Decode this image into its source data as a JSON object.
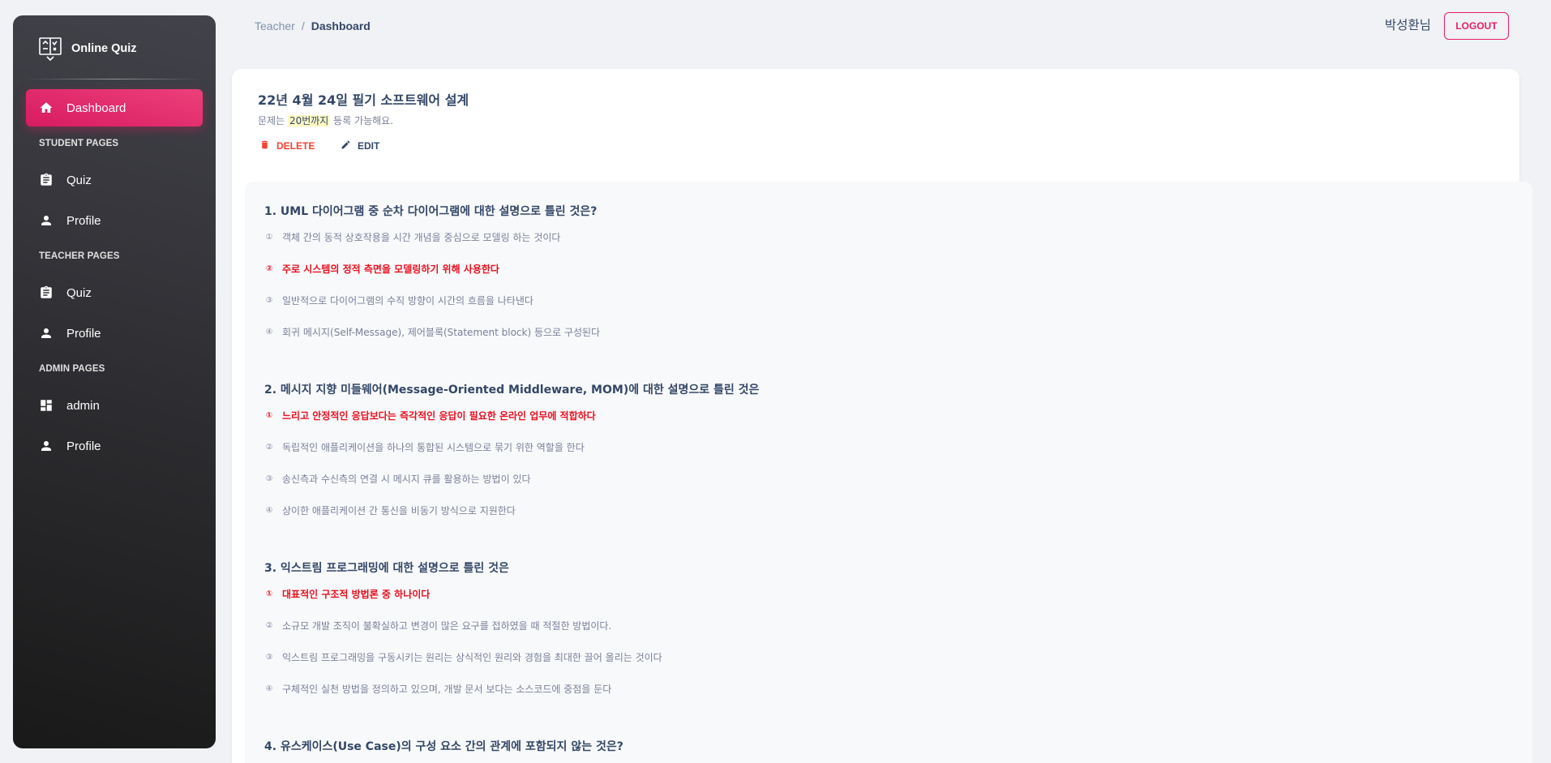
{
  "sidebar": {
    "brand": "Online Quiz",
    "items": [
      {
        "label": "Dashboard",
        "icon": "home-icon",
        "active": true
      },
      {
        "section": "STUDENT PAGES"
      },
      {
        "label": "Quiz",
        "icon": "assignment-icon"
      },
      {
        "label": "Profile",
        "icon": "person-icon"
      },
      {
        "section": "TEACHER PAGES"
      },
      {
        "label": "Quiz",
        "icon": "assignment-icon"
      },
      {
        "label": "Profile",
        "icon": "person-icon"
      },
      {
        "section": "ADMIN PAGES"
      },
      {
        "label": "admin",
        "icon": "dashboard-grid-icon"
      },
      {
        "label": "Profile",
        "icon": "person-icon"
      }
    ],
    "labels": {
      "dashboard": "Dashboard",
      "student_section": "STUDENT PAGES",
      "student_quiz": "Quiz",
      "student_profile": "Profile",
      "teacher_section": "TEACHER PAGES",
      "teacher_quiz": "Quiz",
      "teacher_profile": "Profile",
      "admin_section": "ADMIN PAGES",
      "admin": "admin",
      "admin_profile": "Profile"
    }
  },
  "header": {
    "breadcrumb": [
      "Teacher",
      "/",
      "Dashboard"
    ],
    "user": "박성환님",
    "logout": "LOGOUT"
  },
  "quiz": {
    "title": "22년 4월 24일 필기 소프트웨어 설계",
    "subtitle_prefix": "문제는",
    "subtitle_highlight": "20번까지",
    "subtitle_suffix": "등록 가능해요.",
    "delete_label": "DELETE",
    "edit_label": "EDIT"
  },
  "questions": [
    {
      "title": "1. UML 다이어그램 중 순차 다이어그램에 대한 설명으로 틀린 것은?",
      "choices": [
        {
          "num": "①",
          "text": "객체 간의 동적 상호작용을 시간 개념을 중심으로 모델링 하는 것이다",
          "correct": false
        },
        {
          "num": "②",
          "text": "주로 시스템의 정적 측면을 모델링하기 위해 사용한다",
          "correct": true
        },
        {
          "num": "③",
          "text": "일반적으로 다이어그램의 수직 방향이 시간의 흐름을 나타낸다",
          "correct": false
        },
        {
          "num": "④",
          "text": "회귀 메시지(Self-Message), 제어블록(Statement block) 등으로 구성된다",
          "correct": false
        }
      ]
    },
    {
      "title": "2. 메시지 지향 미들웨어(Message-Oriented Middleware, MOM)에 대한 설명으로 틀린 것은",
      "choices": [
        {
          "num": "①",
          "text": "느리고 안정적인 응답보다는 즉각적인 응답이 필요한 온라인 업무에 적합하다",
          "correct": true
        },
        {
          "num": "②",
          "text": "독립적인 애플리케이션을 하나의 통합된 시스템으로 묶기 위한 역할을 한다",
          "correct": false
        },
        {
          "num": "③",
          "text": "송신측과 수신측의 연결 시 메시지 큐를 활용하는 방법이 있다",
          "correct": false
        },
        {
          "num": "④",
          "text": "상이한 애플리케이션 간 통신을 비동기 방식으로 지원한다",
          "correct": false
        }
      ]
    },
    {
      "title": "3. 익스트림 프로그래밍에 대한 설명으로 틀린 것은",
      "choices": [
        {
          "num": "①",
          "text": "대표적인 구조적 방법론 중 하나이다",
          "correct": true
        },
        {
          "num": "②",
          "text": "소규모 개발 조직이 불확실하고 변경이 많은 요구를 접하였을 때 적절한 방법이다.",
          "correct": false
        },
        {
          "num": "③",
          "text": "익스트림 프로그래밍을 구동시키는 원리는 상식적인 원리와 경험을 최대한 끌어 올리는 것이다",
          "correct": false
        },
        {
          "num": "④",
          "text": "구체적인 실천 방법을 정의하고 있으며, 개발 문서 보다는 소스코드에 중점을 둔다",
          "correct": false
        }
      ]
    },
    {
      "title": "4. 유스케이스(Use Case)의 구성 요소 간의 관계에 포함되지 않는 것은?",
      "choices": []
    }
  ],
  "colors": {
    "accent": "#e91e63",
    "correct": "#e8101f",
    "delete": "#f44335",
    "text": "#344767",
    "muted": "#7b809a"
  }
}
